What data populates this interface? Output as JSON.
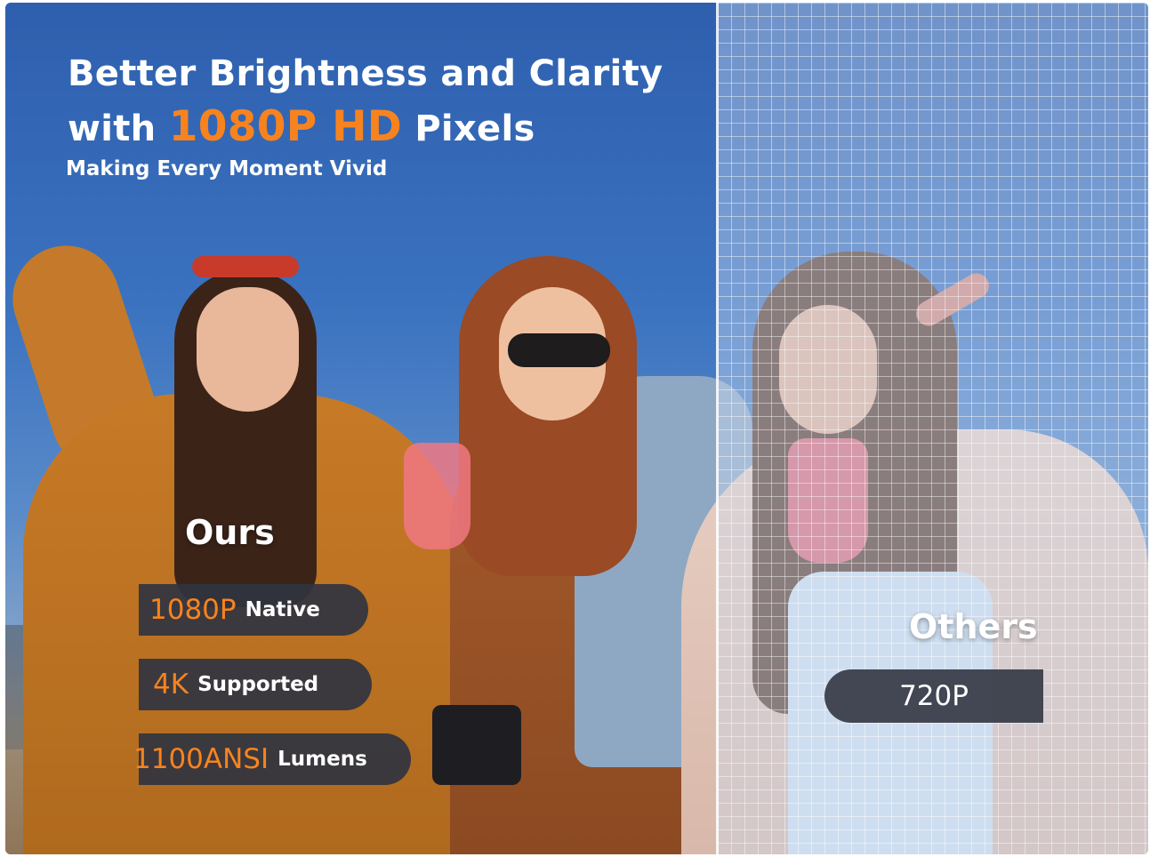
{
  "headline": {
    "line1": "Better Brightness and Clarity",
    "line2_prefix": "with",
    "line2_accent": "1080P HD",
    "line2_suffix": "Pixels"
  },
  "subtitle": "Making Every Moment Vivid",
  "ours": {
    "label": "Ours",
    "specs": [
      {
        "value": "1080P",
        "caption": "Native"
      },
      {
        "value": "4K",
        "caption": "Supported"
      },
      {
        "value": "1100ANSI",
        "caption": "Lumens"
      }
    ]
  },
  "others": {
    "label": "Others",
    "spec": "720P"
  },
  "colors": {
    "accent": "#f7831f",
    "pill_background": "#30343f",
    "sky_blue": "#3a72c0",
    "text": "#ffffff"
  }
}
